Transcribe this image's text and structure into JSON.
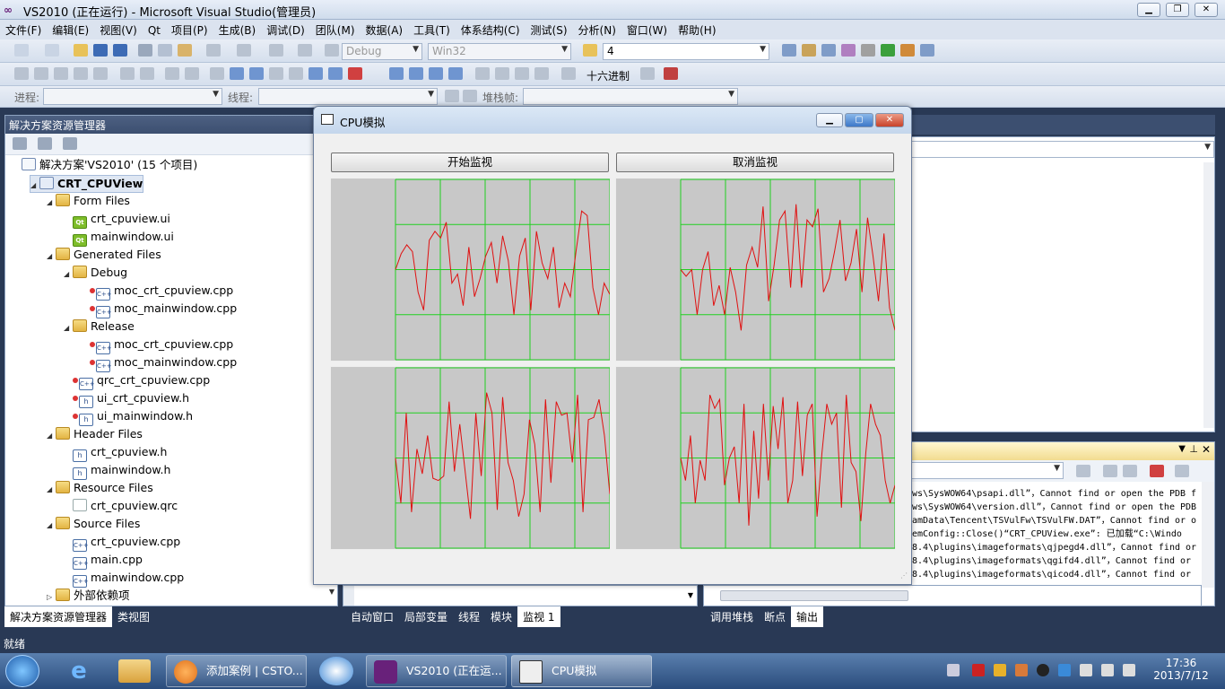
{
  "window": {
    "title": "VS2010 (正在运行) - Microsoft Visual Studio(管理员)"
  },
  "menu": [
    "文件(F)",
    "编辑(E)",
    "视图(V)",
    "Qt",
    "项目(P)",
    "生成(B)",
    "调试(D)",
    "团队(M)",
    "数据(A)",
    "工具(T)",
    "体系结构(C)",
    "测试(S)",
    "分析(N)",
    "窗口(W)",
    "帮助(H)"
  ],
  "toolbar1": {
    "config": "Debug",
    "platform": "Win32",
    "find_value": "4"
  },
  "toolbar2": {
    "hex_label": "十六进制"
  },
  "toolbar3": {
    "process_label": "进程:",
    "thread_label": "线程:",
    "stackframe_label": "堆栈帧:"
  },
  "solution_explorer": {
    "title": "解决方案资源管理器",
    "items": [
      {
        "label": "解决方案'VS2010' (15 个项目)",
        "icon": "solution-icon"
      },
      {
        "label": "CRT_CPUView",
        "icon": "project-icon"
      },
      {
        "label": "Form Files",
        "icon": "folder-icon"
      },
      {
        "label": "crt_cpuview.ui",
        "icon": "qt-icon"
      },
      {
        "label": "mainwindow.ui",
        "icon": "qt-icon"
      },
      {
        "label": "Generated Files",
        "icon": "folder-icon"
      },
      {
        "label": "Debug",
        "icon": "folder-icon"
      },
      {
        "label": "moc_crt_cpuview.cpp",
        "icon": "cpp-icon"
      },
      {
        "label": "moc_mainwindow.cpp",
        "icon": "cpp-icon"
      },
      {
        "label": "Release",
        "icon": "folder-icon"
      },
      {
        "label": "moc_crt_cpuview.cpp",
        "icon": "cpp-icon"
      },
      {
        "label": "moc_mainwindow.cpp",
        "icon": "cpp-icon"
      },
      {
        "label": "qrc_crt_cpuview.cpp",
        "icon": "cpp-icon"
      },
      {
        "label": "ui_crt_cpuview.h",
        "icon": "header-icon"
      },
      {
        "label": "ui_mainwindow.h",
        "icon": "header-icon"
      },
      {
        "label": "Header Files",
        "icon": "folder-icon"
      },
      {
        "label": "crt_cpuview.h",
        "icon": "header-icon"
      },
      {
        "label": "mainwindow.h",
        "icon": "header-icon"
      },
      {
        "label": "Resource Files",
        "icon": "folder-icon"
      },
      {
        "label": "crt_cpuview.qrc",
        "icon": "file-icon"
      },
      {
        "label": "Source Files",
        "icon": "folder-icon"
      },
      {
        "label": "crt_cpuview.cpp",
        "icon": "cpp-icon"
      },
      {
        "label": "main.cpp",
        "icon": "cpp-icon"
      },
      {
        "label": "mainwindow.cpp",
        "icon": "cpp-icon"
      },
      {
        "label": "外部依赖项",
        "icon": "folder-icon"
      }
    ]
  },
  "left_tabs": [
    "解决方案资源管理器",
    "类视图"
  ],
  "debug_tabs": [
    "自动窗口",
    "局部变量",
    "线程",
    "模块",
    "监视 1"
  ],
  "output_tabs": [
    "调用堆栈",
    "断点",
    "输出"
  ],
  "output_lines": [
    "ws\\SysWOW64\\psapi.dll”，Cannot find or open the PDB f",
    "ws\\SysWOW64\\version.dll”，Cannot find or open the PDB",
    "amData\\Tencent\\TSVulFw\\TSVulFW.DAT”，Cannot find or o",
    "emConfig::Close()“CRT_CPUView.exe”: 已加载“C:\\Windo",
    "8.4\\plugins\\imageformats\\qjpegd4.dll”，Cannot find or",
    "8.4\\plugins\\imageformats\\qgifd4.dll”，Cannot find or",
    "8.4\\plugins\\imageformats\\qicod4.dll”，Cannot find or"
  ],
  "dialog": {
    "title": "CPU模拟",
    "start_button": "开始监视",
    "cancel_button": "取消监视"
  },
  "chart_data": [
    {
      "type": "line",
      "values": [
        0.0,
        0.35,
        0.55,
        0.4,
        -0.5,
        -0.9,
        0.65,
        0.85,
        0.7,
        1.05,
        -0.3,
        -0.1,
        -0.8,
        0.5,
        -0.6,
        -0.2,
        0.3,
        0.6,
        -0.3,
        0.75,
        0.2,
        -1.0,
        0.3,
        0.7,
        -0.9,
        0.85,
        0.15,
        -0.2,
        0.5,
        -0.85,
        -0.3,
        -0.6,
        0.4,
        1.3,
        1.2,
        -0.4,
        -1.0,
        -0.3,
        -0.55
      ],
      "ylim": [
        -2,
        2
      ],
      "series_color": "#e01010",
      "grid_color": "#20d020"
    },
    {
      "type": "line",
      "values": [
        0.0,
        -0.15,
        0.0,
        -1.0,
        0.0,
        0.4,
        -0.8,
        -0.35,
        -1.0,
        0.05,
        -0.5,
        -1.35,
        0.1,
        0.5,
        0.05,
        1.4,
        -0.7,
        0.1,
        1.1,
        1.3,
        -0.4,
        1.45,
        -0.4,
        1.1,
        0.95,
        1.35,
        -0.5,
        -0.2,
        0.4,
        1.1,
        -0.25,
        0.15,
        0.9,
        -0.5,
        1.15,
        0.3,
        -0.7,
        0.8,
        -0.85,
        -1.35
      ]
    },
    {
      "type": "line",
      "values": [
        0.0,
        -1.0,
        1.0,
        -1.2,
        0.2,
        -0.35,
        0.5,
        -0.45,
        -0.5,
        -0.4,
        1.25,
        -0.3,
        0.75,
        -0.3,
        -1.35,
        1.0,
        -0.4,
        1.45,
        1.0,
        -1.15,
        1.35,
        -0.1,
        -0.5,
        -1.3,
        -0.8,
        0.85,
        0.3,
        -1.2,
        1.3,
        -0.55,
        1.25,
        0.95,
        1.0,
        -0.1,
        1.4,
        -1.2,
        0.85,
        0.9,
        1.3,
        0.5,
        -0.8
      ]
    },
    {
      "type": "line",
      "values": [
        0.0,
        -0.5,
        0.5,
        -1.0,
        -0.05,
        -0.5,
        1.4,
        1.1,
        1.3,
        -0.6,
        0.0,
        0.25,
        -1.0,
        1.2,
        -1.5,
        0.6,
        -0.9,
        1.2,
        -0.5,
        1.15,
        0.2,
        1.35,
        -1.0,
        -0.5,
        1.25,
        -0.4,
        0.95,
        1.2,
        -1.3,
        0.1,
        1.2,
        0.75,
        1.0,
        -1.1,
        1.4,
        -0.1,
        -0.3,
        -1.4,
        0.1,
        1.2,
        0.75,
        0.5,
        -0.5,
        -1.0,
        -0.6
      ]
    }
  ],
  "status": {
    "text": "就绪"
  },
  "taskbar": {
    "tasks": [
      "添加案例 | CSTO...",
      "VS2010 (正在运...",
      "CPU模拟"
    ],
    "time": "17:36",
    "date": "2013/7/12"
  }
}
